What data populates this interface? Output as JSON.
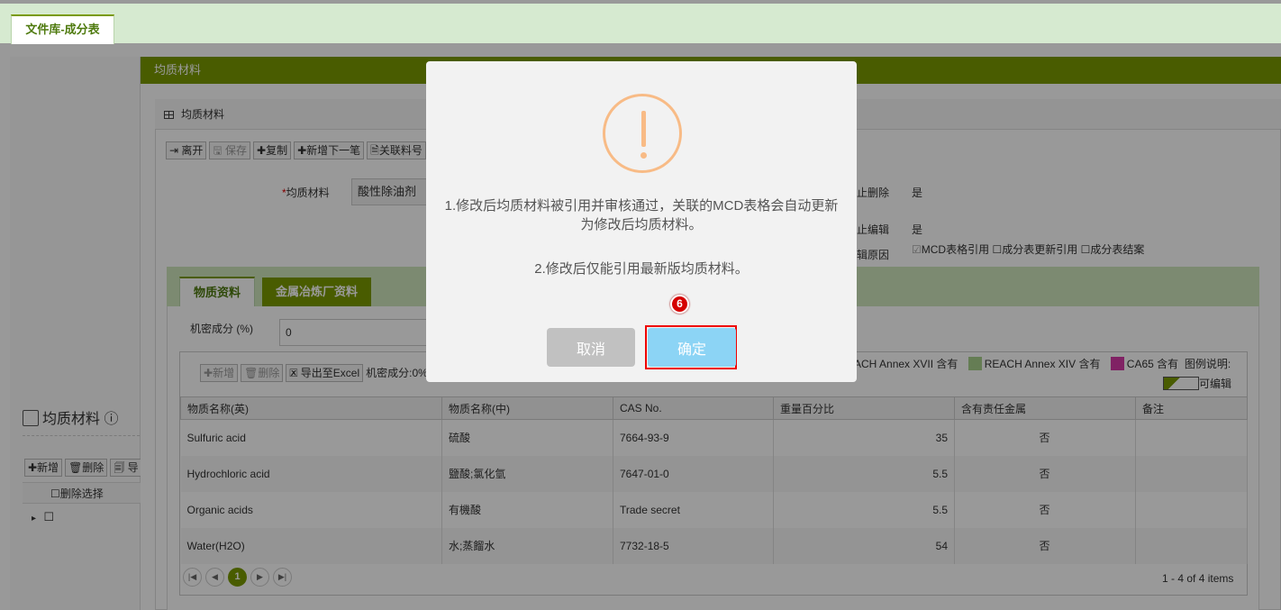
{
  "top_tab": {
    "label": "文件库-成分表"
  },
  "left_pane": {
    "title": "均质材料",
    "buttons": {
      "add": "✚新增",
      "delete": "🗑删除",
      "more": "🗐 导"
    },
    "header_checkbox_label": "删除选择"
  },
  "panel": {
    "header": "均质材料",
    "inner_header": "均质材料",
    "toolbar": {
      "leave": "离开",
      "save": "保存",
      "copy": "复制",
      "add_next": "新增下一笔",
      "link": "关联料号"
    },
    "form": {
      "material_label": "均质材料",
      "material_value": "酸性除油剂",
      "forbid_delete_label": "止删除",
      "forbid_delete_value": "是",
      "forbid_edit_label": "止编辑",
      "forbid_edit_value": "是",
      "reason_label": "辑原因",
      "reasons": [
        "MCD表格引用",
        "成分表更新引用",
        "成分表结案"
      ]
    }
  },
  "tabs": [
    {
      "label": "物质资料",
      "active": true
    },
    {
      "label": "金属冶炼厂资料",
      "active": false
    }
  ],
  "substance": {
    "secret_label": "机密成分 (%)",
    "secret_value": "0",
    "grid_tools": {
      "add": "新增",
      "delete": "删除",
      "export": "导出至Excel",
      "secret_text": "机密成分:0%"
    },
    "legend": {
      "reach17": "EACH Annex XVII 含有",
      "reach14": "REACH Annex XIV 含有",
      "ca65": "CA65 含有",
      "note": "图例说明:",
      "editable": "可编辑",
      "colors": {
        "reach14": "#a8d08d",
        "ca65": "#d63aa7"
      }
    },
    "columns": [
      "物质名称(英)",
      "物质名称(中)",
      "CAS No.",
      "重量百分比",
      "含有责任金属",
      "备注"
    ],
    "rows": [
      {
        "en": "Sulfuric acid",
        "cn": "硫酸",
        "cas": "7664-93-9",
        "pct": "35",
        "metal": "否",
        "note": ""
      },
      {
        "en": "Hydrochloric acid",
        "cn": "鹽酸;氯化氫",
        "cas": "7647-01-0",
        "pct": "5.5",
        "metal": "否",
        "note": ""
      },
      {
        "en": "Organic acids",
        "cn": "有機酸",
        "cas": "Trade secret",
        "pct": "5.5",
        "metal": "否",
        "note": ""
      },
      {
        "en": "Water(H2O)",
        "cn": "水;蒸餾水",
        "cas": "7732-18-5",
        "pct": "54",
        "metal": "否",
        "note": ""
      }
    ],
    "pager": {
      "current": "1",
      "info": "1 - 4 of 4 items"
    }
  },
  "modal": {
    "message1": "1.修改后均质材料被引用并审核通过，关联的MCD表格会自动更新为修改后均质材料。",
    "message2": "2.修改后仅能引用最新版均质材料。",
    "cancel": "取消",
    "confirm": "确定",
    "step_badge": "6"
  },
  "colors": {
    "brand_green": "#7a9a01",
    "warning": "#f8bb86",
    "confirm": "#8cd4f5"
  }
}
